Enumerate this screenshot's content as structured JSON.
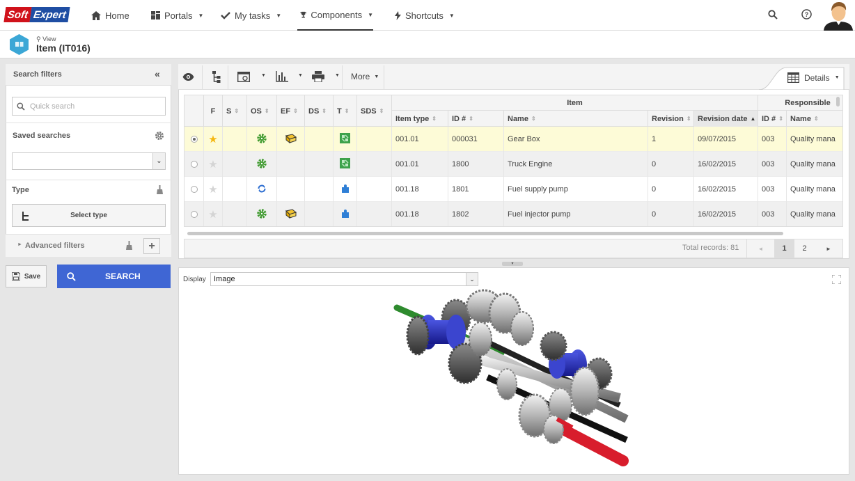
{
  "nav": {
    "logo_left": "Soft",
    "logo_right": "Expert",
    "items": [
      {
        "label": "Home",
        "icon": "home-icon"
      },
      {
        "label": "Portals",
        "icon": "portals-icon"
      },
      {
        "label": "My tasks",
        "icon": "check-icon"
      },
      {
        "label": "Components",
        "icon": "trophy-icon"
      },
      {
        "label": "Shortcuts",
        "icon": "bolt-icon"
      }
    ],
    "active": "Components"
  },
  "breadcrumb": {
    "view_label": "View",
    "title": "Item (IT016)"
  },
  "filters": {
    "header": "Search filters",
    "quick_search_placeholder": "Quick search",
    "saved_searches_label": "Saved searches",
    "saved_search_value": "",
    "type_label": "Type",
    "select_type_label": "Select type",
    "advanced_label": "Advanced filters",
    "save_label": "Save",
    "search_label": "SEARCH"
  },
  "toolbar": {
    "more_label": "More",
    "details_label": "Details"
  },
  "grid": {
    "group_headers": {
      "item": "Item",
      "responsible": "Responsible"
    },
    "columns": [
      "F",
      "S",
      "OS",
      "EF",
      "DS",
      "T",
      "SDS",
      "Item type",
      "ID #",
      "Name",
      "Revision",
      "Revision date",
      "ID #",
      "Name"
    ],
    "rows": [
      {
        "selected": true,
        "favorite": true,
        "os": "gear-status-icon",
        "ef": "folder-yellow-icon",
        "t": "type-green-icon",
        "item_type": "001.01",
        "id": "000031",
        "name": "Gear Box",
        "revision": "1",
        "revision_date": "09/07/2015",
        "resp_id": "003",
        "resp_name": "Quality mana"
      },
      {
        "selected": false,
        "favorite": false,
        "os": "gear-status-icon",
        "ef": "",
        "t": "type-green-icon",
        "item_type": "001.01",
        "id": "1800",
        "name": "Truck Engine",
        "revision": "0",
        "revision_date": "16/02/2015",
        "resp_id": "003",
        "resp_name": "Quality mana"
      },
      {
        "selected": false,
        "favorite": false,
        "os": "refresh-status-icon",
        "ef": "",
        "t": "puzzle-blue-icon",
        "item_type": "001.18",
        "id": "1801",
        "name": "Fuel supply pump",
        "revision": "0",
        "revision_date": "16/02/2015",
        "resp_id": "003",
        "resp_name": "Quality mana"
      },
      {
        "selected": false,
        "favorite": false,
        "os": "gear-status-icon",
        "ef": "folder-yellow-icon",
        "t": "puzzle-blue-icon",
        "item_type": "001.18",
        "id": "1802",
        "name": "Fuel injector pump",
        "revision": "0",
        "revision_date": "16/02/2015",
        "resp_id": "003",
        "resp_name": "Quality mana"
      }
    ],
    "total_records": "Total records: 81",
    "pages": [
      "1",
      "2"
    ],
    "current_page": "1"
  },
  "display": {
    "label": "Display",
    "value": "Image"
  },
  "colors": {
    "accent": "#3f66d4",
    "selected_row": "#fdfbd7",
    "logo_red": "#d0121b",
    "logo_blue": "#1f4ea3",
    "cube": "#3ba7d6"
  }
}
